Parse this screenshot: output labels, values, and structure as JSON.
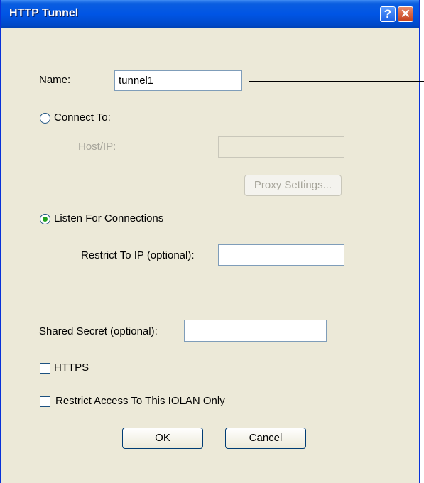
{
  "window": {
    "title": "HTTP Tunnel",
    "help_glyph": "?",
    "close_glyph": "✕"
  },
  "name": {
    "label": "Name:",
    "value": "tunnel1"
  },
  "connect_to": {
    "label": "Connect To:",
    "selected": false
  },
  "host_ip": {
    "label": "Host/IP:",
    "value": ""
  },
  "proxy_settings": {
    "label": "Proxy Settings..."
  },
  "listen": {
    "label": "Listen For Connections",
    "selected": true
  },
  "restrict_ip": {
    "label": "Restrict To IP (optional):",
    "value": ""
  },
  "shared_secret": {
    "label": "Shared Secret (optional):",
    "value": ""
  },
  "https": {
    "label": "HTTPS",
    "checked": false
  },
  "restrict_access": {
    "label": "Restrict Access To This IOLAN Only",
    "checked": false
  },
  "buttons": {
    "ok": "OK",
    "cancel": "Cancel"
  },
  "colors": {
    "titlebar": "#0055e5",
    "face": "#ece9d8",
    "radio_dot": "#21a121"
  }
}
